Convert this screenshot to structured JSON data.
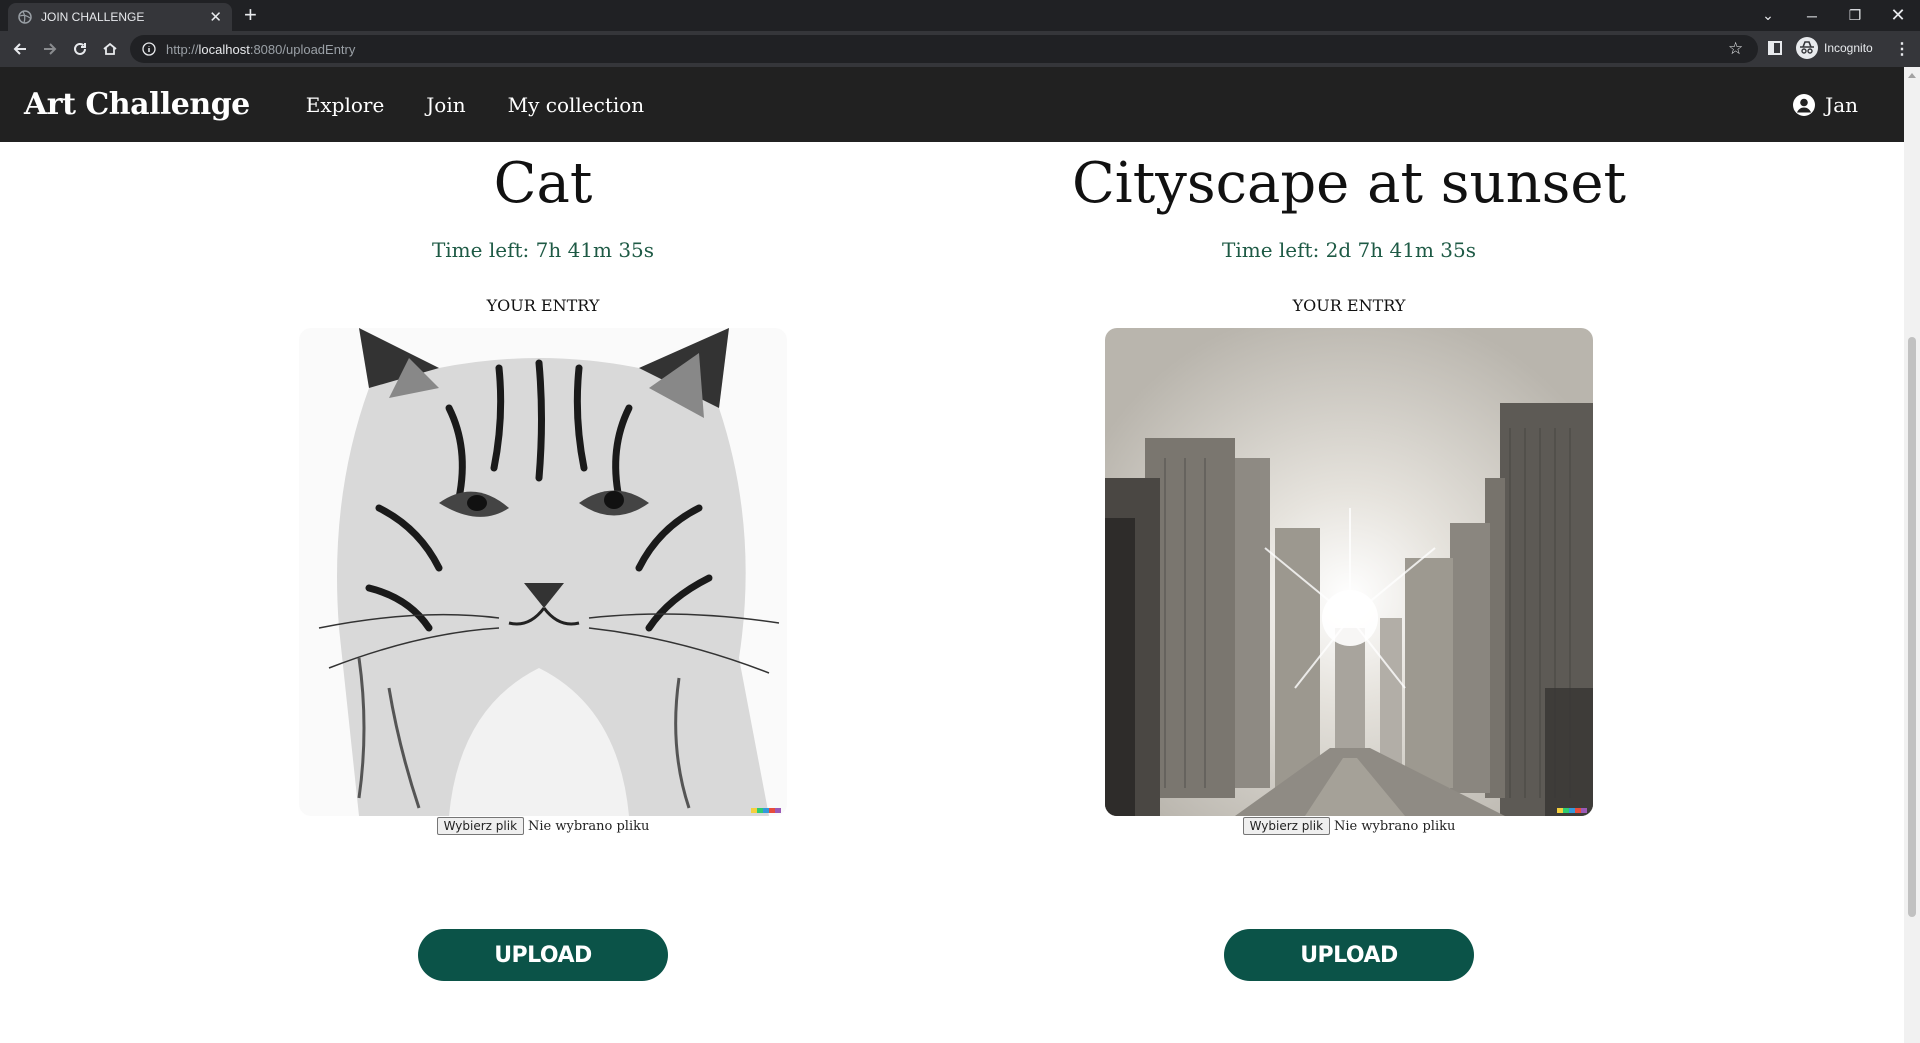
{
  "browser": {
    "tab_title": "JOIN CHALLENGE",
    "url_prefix": "http://",
    "url_host": "localhost",
    "url_rest": ":8080/uploadEntry",
    "incognito_label": "Incognito"
  },
  "navbar": {
    "brand": "Art Challenge",
    "links": [
      "Explore",
      "Join",
      "My collection"
    ],
    "user": "Jan"
  },
  "challenges": [
    {
      "title": "Cat",
      "time_left": "Time left: 7h 41m 35s",
      "entry_label": "YOUR ENTRY",
      "file_button": "Wybierz plik",
      "file_status": "Nie wybrano pliku",
      "upload_label": "UPLOAD"
    },
    {
      "title": "Cityscape at sunset",
      "time_left": "Time left: 2d 7h 41m 35s",
      "entry_label": "YOUR ENTRY",
      "file_button": "Wybierz plik",
      "file_status": "Nie wybrano pliku",
      "upload_label": "UPLOAD"
    }
  ],
  "colors": {
    "navbar_bg": "#212121",
    "accent": "#0b5348",
    "time_text": "#1e5a45"
  }
}
